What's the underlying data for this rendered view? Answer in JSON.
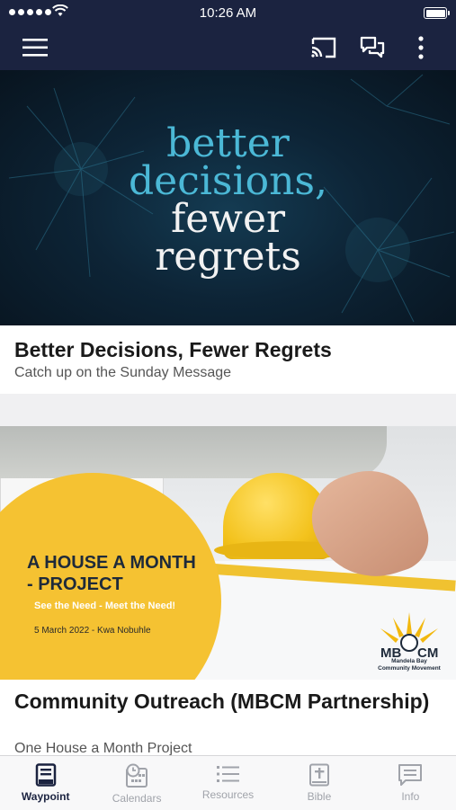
{
  "status_bar": {
    "time": "10:26 AM"
  },
  "header": {
    "menu_icon": "hamburger-icon",
    "cast_icon": "cast-icon",
    "chat_icon": "chat-bubbles-icon",
    "more_icon": "vertical-ellipsis-icon"
  },
  "feed": {
    "items": [
      {
        "banner_lines": [
          "better",
          "decisions,",
          "fewer",
          "regrets"
        ],
        "title": "Better Decisions, Fewer Regrets",
        "subtitle": "Catch up on the Sunday Message"
      },
      {
        "banner_title": "A HOUSE A MONTH - PROJECT",
        "banner_title_line1": "A HOUSE A MONTH",
        "banner_title_line2": "- PROJECT",
        "banner_tagline": "See the Need - Meet the Need!",
        "banner_date": "5 March 2022 - Kwa Nobuhle",
        "logo_text_left": "MB",
        "logo_text_right": "CM",
        "logo_sub_line1": "Mandela Bay",
        "logo_sub_line2": "Community Movement",
        "title": "Community Outreach (MBCM Partnership)",
        "subtitle": "One House a Month Project"
      }
    ]
  },
  "tabbar": {
    "tabs": [
      {
        "label": "Waypoint",
        "icon": "book-icon",
        "active": true
      },
      {
        "label": "Calendars",
        "icon": "calendar-clock-icon",
        "active": false
      },
      {
        "label": "Resources",
        "icon": "list-icon",
        "active": false
      },
      {
        "label": "Bible",
        "icon": "bible-icon",
        "active": false
      },
      {
        "label": "Info",
        "icon": "info-message-icon",
        "active": false
      }
    ]
  },
  "colors": {
    "header_bg": "#1b2340",
    "accent_active": "#1b2340",
    "inactive": "#a0a3aa"
  }
}
